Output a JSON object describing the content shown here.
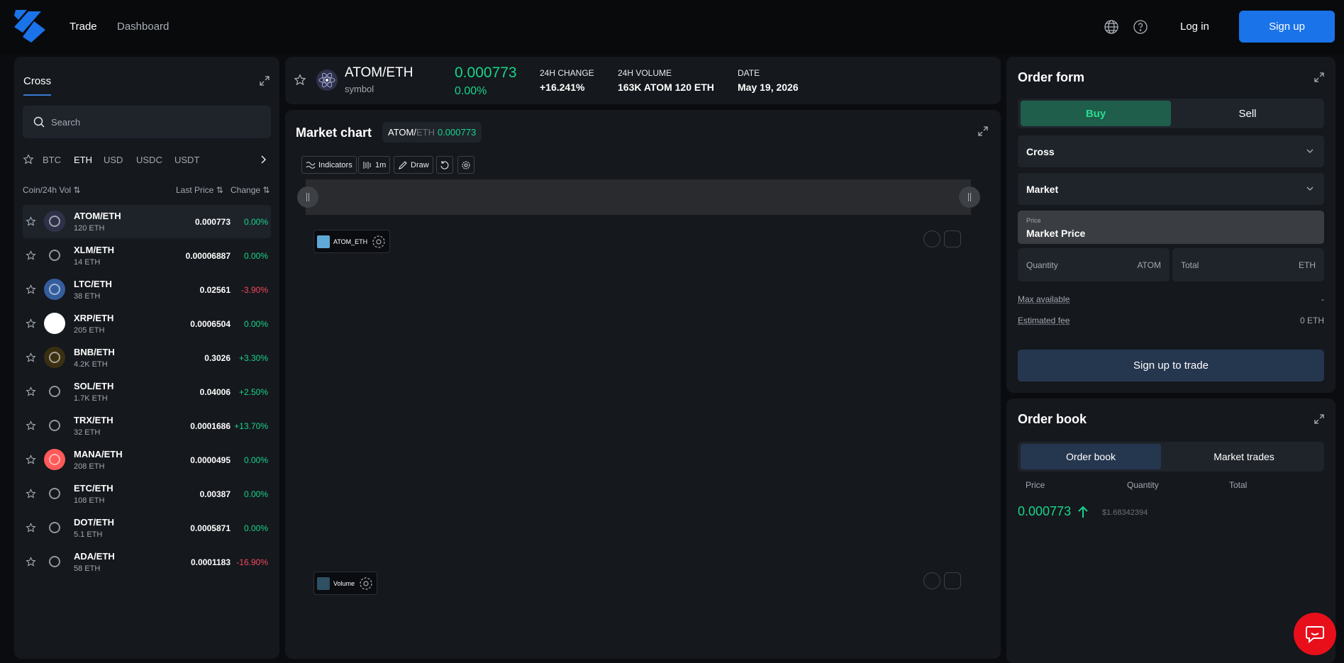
{
  "header": {
    "nav": [
      {
        "label": "Trade",
        "active": true
      },
      {
        "label": "Dashboard",
        "active": false
      }
    ],
    "icons": [
      "globe-icon",
      "help-icon"
    ],
    "login_label": "Log in",
    "signup_label": "Sign up"
  },
  "markets": {
    "tab": "Cross",
    "search_placeholder": "Search",
    "filters": [
      "BTC",
      "ETH",
      "USD",
      "USDC",
      "USDT"
    ],
    "active_filter": "ETH",
    "columns": {
      "coin": "Coin/24h Vol",
      "price": "Last Price",
      "change": "Change"
    },
    "rows": [
      {
        "pair": "ATOM/ETH",
        "vol": "120 ETH",
        "price": "0.000773",
        "change": "0.00%",
        "trend": "pos",
        "icon": "atom-icon",
        "color": "#2e3148"
      },
      {
        "pair": "XLM/ETH",
        "vol": "14 ETH",
        "price": "0.00006887",
        "change": "0.00%",
        "trend": "pos",
        "icon": "stellar-icon",
        "color": "#15181d"
      },
      {
        "pair": "LTC/ETH",
        "vol": "38 ETH",
        "price": "0.02561",
        "change": "-3.90%",
        "trend": "neg",
        "icon": "litecoin-icon",
        "color": "#345d9d"
      },
      {
        "pair": "XRP/ETH",
        "vol": "205 ETH",
        "price": "0.0006504",
        "change": "0.00%",
        "trend": "pos",
        "icon": "xrp-icon",
        "color": "#ffffff"
      },
      {
        "pair": "BNB/ETH",
        "vol": "4.2K ETH",
        "price": "0.3026",
        "change": "+3.30%",
        "trend": "pos",
        "icon": "bnb-icon",
        "color": "#3b2f12"
      },
      {
        "pair": "SOL/ETH",
        "vol": "1.7K ETH",
        "price": "0.04006",
        "change": "+2.50%",
        "trend": "pos",
        "icon": "solana-icon",
        "color": "#15181d"
      },
      {
        "pair": "TRX/ETH",
        "vol": "32 ETH",
        "price": "0.0001686",
        "change": "+13.70%",
        "trend": "pos",
        "icon": "tron-icon",
        "color": "#15181d"
      },
      {
        "pair": "MANA/ETH",
        "vol": "208 ETH",
        "price": "0.0000495",
        "change": "0.00%",
        "trend": "pos",
        "icon": "mana-icon",
        "color": "#ff5a5a"
      },
      {
        "pair": "ETC/ETH",
        "vol": "108 ETH",
        "price": "0.00387",
        "change": "0.00%",
        "trend": "pos",
        "icon": "etc-icon",
        "color": "#15181d"
      },
      {
        "pair": "DOT/ETH",
        "vol": "5.1 ETH",
        "price": "0.0005871",
        "change": "0.00%",
        "trend": "pos",
        "icon": "polkadot-icon",
        "color": "#15181d"
      },
      {
        "pair": "ADA/ETH",
        "vol": "58 ETH",
        "price": "0.0001183",
        "change": "-16.90%",
        "trend": "neg",
        "icon": "cardano-icon",
        "color": "#15181d"
      }
    ]
  },
  "ticker": {
    "pair": "ATOM/ETH",
    "sub": "symbol",
    "price": "0.000773",
    "change_pct": "0.00%",
    "stats": [
      {
        "label": "24H CHANGE",
        "value": "+16.241%"
      },
      {
        "label": "24H VOLUME",
        "value": "163K ATOM 120 ETH"
      },
      {
        "label": "DATE",
        "value": "May 19, 2026"
      }
    ]
  },
  "chart": {
    "title": "Market chart",
    "chip_base": "ATOM/",
    "chip_quote": "ETH",
    "chip_price": "0.000773",
    "toolbar": {
      "indicators": "Indicators",
      "interval": "1m",
      "draw": "Draw"
    },
    "main_legend": "ATOM_ETH",
    "volume_legend": "Volume",
    "main_color": "#5fa9d6",
    "volume_color": "#2f4f63"
  },
  "order_form": {
    "title": "Order form",
    "buy_label": "Buy",
    "sell_label": "Sell",
    "margin_mode": "Cross",
    "order_type": "Market",
    "price_label": "Price",
    "price_value": "Market Price",
    "quantity_label": "Quantity",
    "quantity_unit": "ATOM",
    "total_label": "Total",
    "total_unit": "ETH",
    "max_available_label": "Max available",
    "max_available_value": "-",
    "fee_label": "Estimated fee",
    "fee_value": "0 ETH",
    "submit_label": "Sign up to trade"
  },
  "order_book": {
    "title": "Order book",
    "tab_book": "Order book",
    "tab_trades": "Market trades",
    "columns": {
      "price": "Price",
      "quantity": "Quantity",
      "total": "Total"
    },
    "last_price": "0.000773",
    "last_price_usd": "$1.68342394"
  },
  "colors": {
    "positive": "#18d48a",
    "negative": "#f2495d",
    "accent": "#1a73e8",
    "buy": "#1e5e4b",
    "chat": "#e80f1b"
  }
}
